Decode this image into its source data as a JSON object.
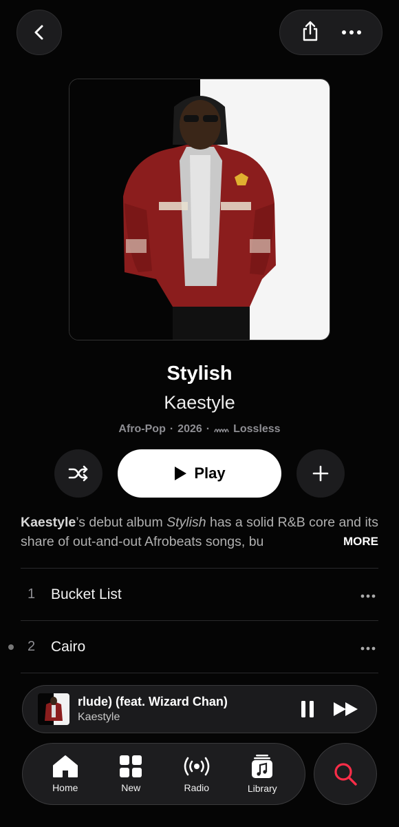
{
  "album": {
    "title": "Stylish",
    "artist": "Kaestyle",
    "genre": "Afro-Pop",
    "year": "2026",
    "quality": "Lossless"
  },
  "actions": {
    "play_label": "Play"
  },
  "description": {
    "artist": "Kaestyle",
    "part1": "’s debut album ",
    "album_italic": "Stylish",
    "part2": " has a solid R&B core and its share of out-and-out Afrobeats songs, bu",
    "more_label": "MORE"
  },
  "tracks": [
    {
      "number": "1",
      "title": "Bucket List"
    },
    {
      "number": "2",
      "title": "Cairo"
    }
  ],
  "mini_player": {
    "song": "rlude) (feat. Wizard Chan)",
    "artist": "Kaestyle"
  },
  "tabs": [
    {
      "label": "Home",
      "icon": "home-icon"
    },
    {
      "label": "New",
      "icon": "grid-icon"
    },
    {
      "label": "Radio",
      "icon": "radio-icon"
    },
    {
      "label": "Library",
      "icon": "library-icon"
    }
  ],
  "colors": {
    "accent": "#fa2d48",
    "background": "#050505",
    "surface": "#1c1c1e"
  }
}
